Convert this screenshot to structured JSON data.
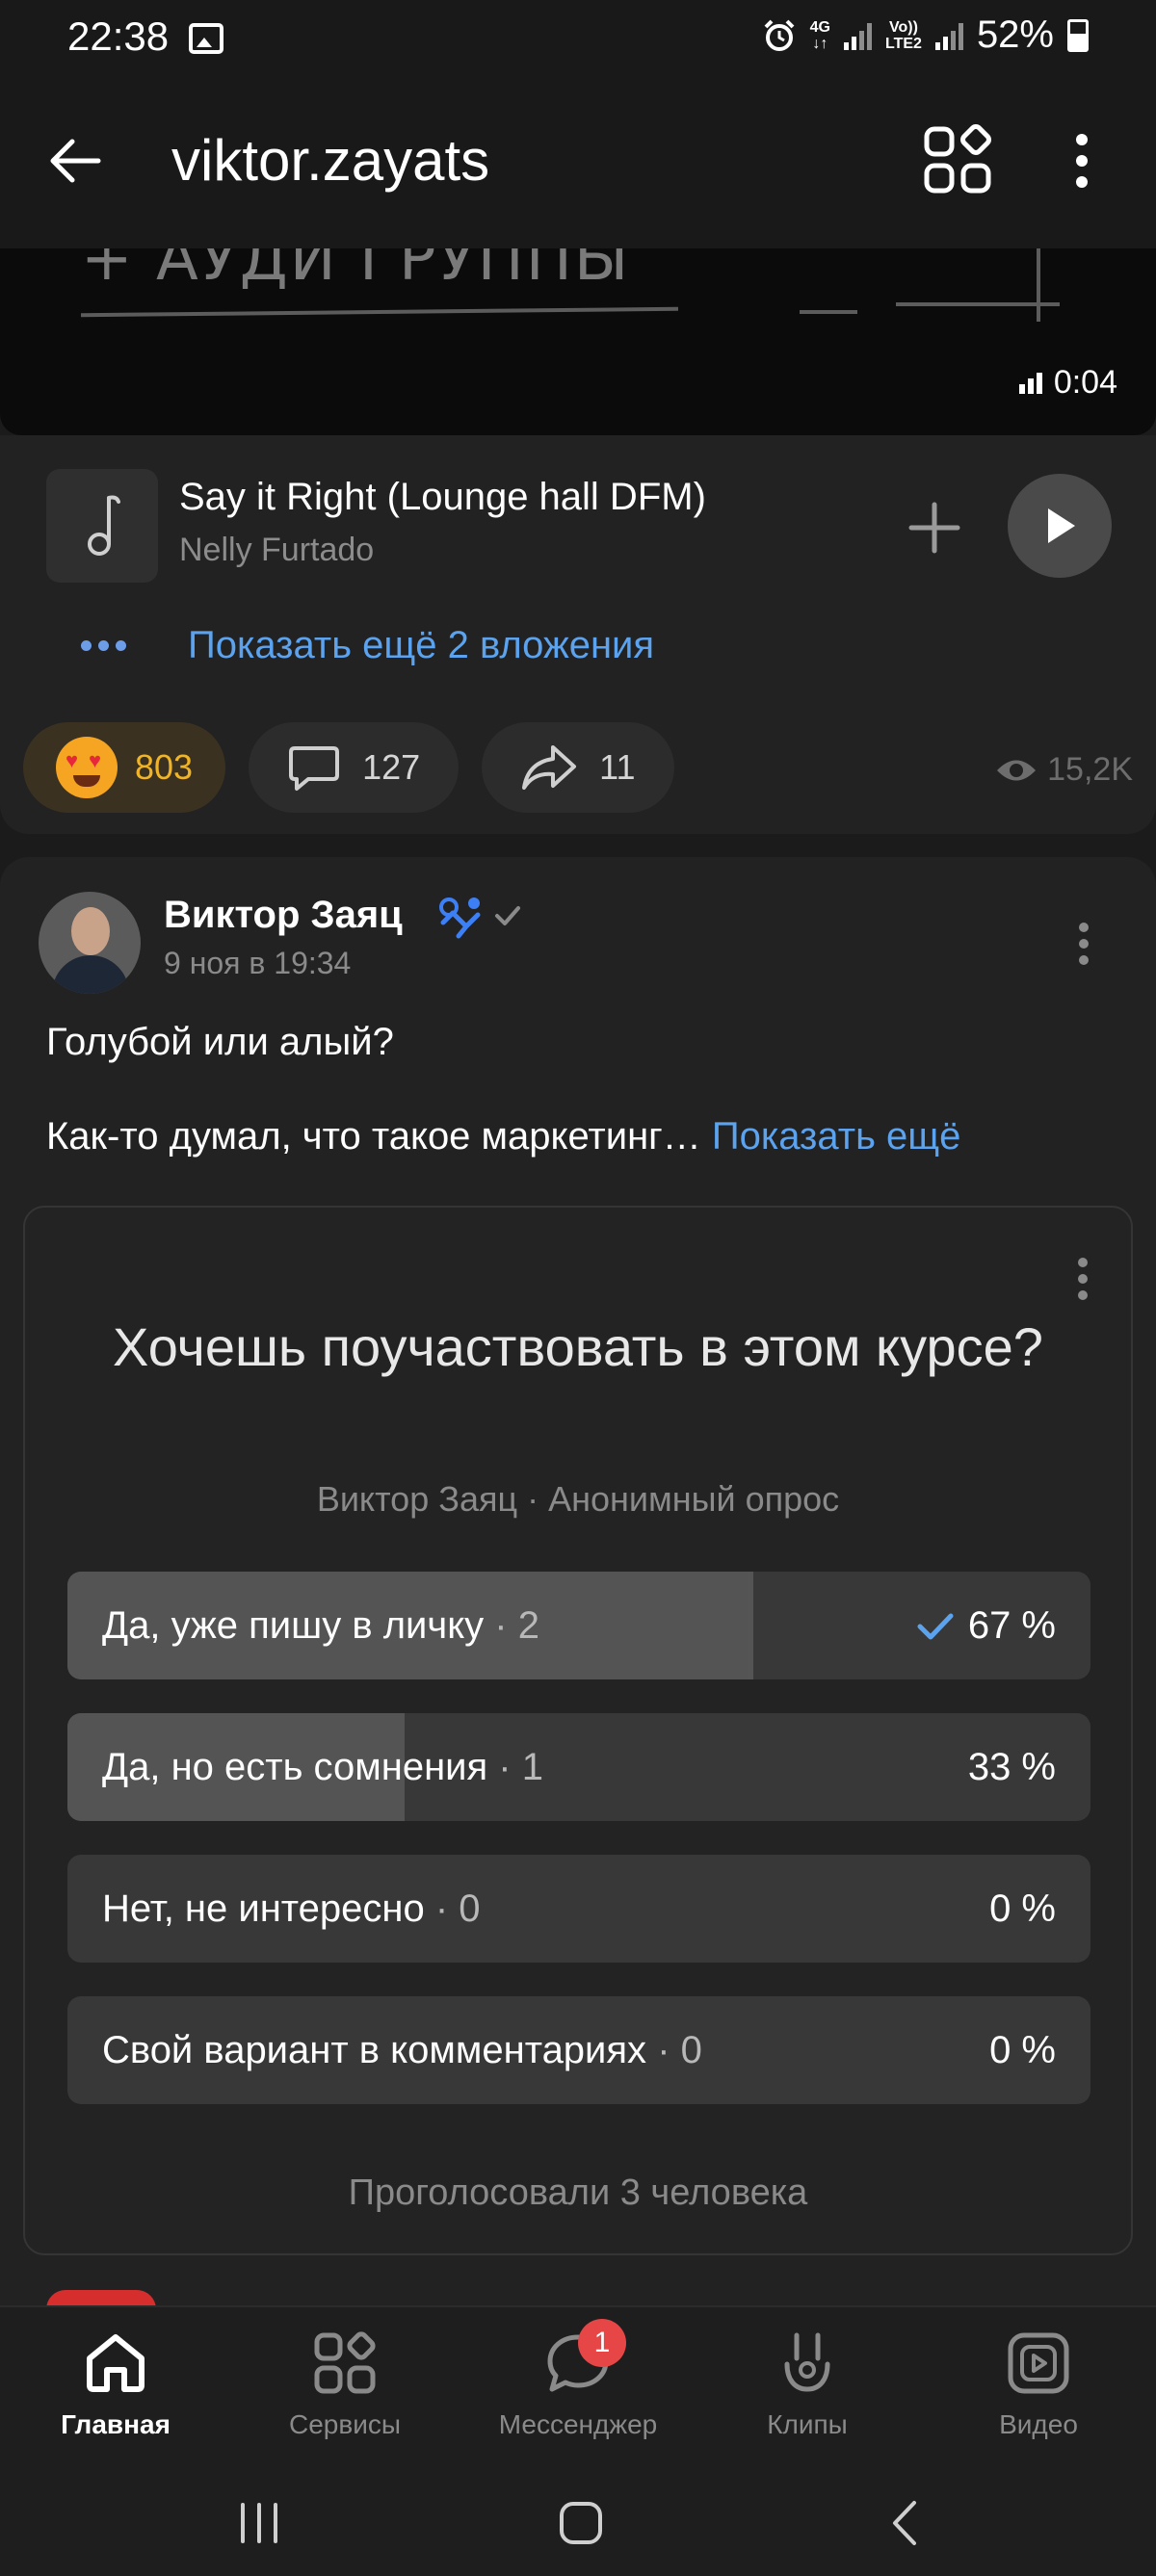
{
  "status_bar": {
    "time": "22:38",
    "network_top": "4G",
    "network_bottom": "",
    "volte_top": "Vo))",
    "volte_bottom": "LTE2",
    "battery": "52%"
  },
  "header": {
    "title": "viktor.zayats"
  },
  "video": {
    "overlay_text": "+ АУДИ ГРУППЫ",
    "duration": "0:04"
  },
  "audio": {
    "title": "Say it Right (Lounge hall DFM)",
    "artist": "Nelly Furtado"
  },
  "attachments": {
    "show_more_label": "Показать ещё 2 вложения"
  },
  "post1_stats": {
    "likes": "803",
    "comments": "127",
    "reposts": "11",
    "views": "15,2K"
  },
  "post2": {
    "author": "Виктор Заяц",
    "date": "9 ноя в 19:34",
    "text_line1": "Голубой или алый?",
    "text_line2": "Как-то думал, что такое маркетинг…",
    "show_more": "Показать ещё"
  },
  "poll": {
    "question": "Хочешь поучаствовать в этом курсе?",
    "meta": "Виктор Заяц · Анонимный опрос",
    "options": [
      {
        "label": "Да, уже пишу в личку",
        "count": "· 2",
        "percent": "67 %",
        "fraction": 0.67,
        "voted": true
      },
      {
        "label": "Да, но есть сомнения",
        "count": "· 1",
        "percent": "33 %",
        "fraction": 0.33,
        "voted": false
      },
      {
        "label": "Нет, не интересно",
        "count": "· 0",
        "percent": "0 %",
        "fraction": 0,
        "voted": false
      },
      {
        "label": "Свой вариант в комментариях",
        "count": "· 0",
        "percent": "0 %",
        "fraction": 0,
        "voted": false
      }
    ],
    "footer": "Проголосовали 3 человека"
  },
  "bottom_nav": {
    "items": [
      {
        "label": "Главная",
        "icon": "home-icon",
        "active": true
      },
      {
        "label": "Сервисы",
        "icon": "services-icon",
        "active": false
      },
      {
        "label": "Мессенджер",
        "icon": "messenger-icon",
        "active": false,
        "badge": "1"
      },
      {
        "label": "Клипы",
        "icon": "clips-icon",
        "active": false
      },
      {
        "label": "Видео",
        "icon": "video-icon",
        "active": false
      }
    ]
  },
  "colors": {
    "accent": "#5ba2ef",
    "background": "#1b1b1b",
    "card": "#222222",
    "badge": "#e64646",
    "like_count": "#f0b429"
  }
}
